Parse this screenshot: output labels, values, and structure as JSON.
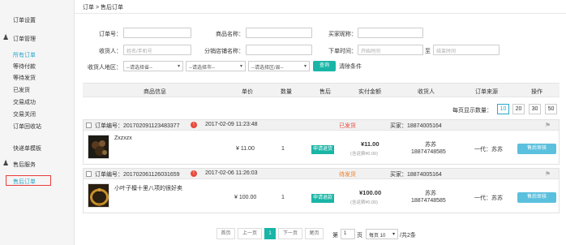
{
  "sidebar": {
    "settings": "订单设置",
    "management": "订单管理",
    "items": [
      "所有订单",
      "等待付款",
      "等待发货",
      "已发货",
      "交易成功",
      "交易关闭",
      "订单回收站"
    ],
    "express": "快递单模板",
    "aftersale": "售后服务",
    "aftersale_order": "售后订单"
  },
  "breadcrumb": "订单 > 售后订单",
  "filters": {
    "order_no": "订单号：",
    "product_name": "商品名称：",
    "buyer_nick": "买家昵称：",
    "recipient": "收货人：",
    "recipient_ph": "姓名/手机号",
    "store_name": "分销店铺名称：",
    "order_time": "下单时间：",
    "start_ph": "开始时间",
    "to": "至",
    "end_ph": "结束时间",
    "region": "收货人地区：",
    "province": "--请选择省--",
    "city": "--请选择市--",
    "district": "--请选择区/县--",
    "query": "查询",
    "clear": "清除条件"
  },
  "columns": [
    "商品信息",
    "单价",
    "数量",
    "售后",
    "实付金额",
    "收货人",
    "订单来源",
    "操作"
  ],
  "per_page": {
    "label": "每页显示数量：",
    "options": [
      "10",
      "20",
      "30",
      "50"
    ],
    "selected": "10"
  },
  "orders": [
    {
      "id_label": "订单编号：201702091123483377",
      "time": "2017-02-09 11:23:48",
      "status": "已发货",
      "buyer": "买家：18874005164",
      "product": "Zxzxzx",
      "price": "¥ 11.00",
      "qty": "1",
      "aftersale": "申请退货",
      "paid": "¥11.00",
      "shipping": "(含运费¥0.00)",
      "receiver_name": "苏苏",
      "receiver_phone": "18874748585",
      "source": "一代：苏苏",
      "action": "售后审核"
    },
    {
      "id_label": "订单编号：201702061126031659",
      "time": "2017-02-06 11:26:03",
      "status": "待发货",
      "buyer": "买家：18874005164",
      "product": "小叶子檀十里八项的很好卖",
      "price": "¥ 100.00",
      "qty": "1",
      "aftersale": "申请退款",
      "paid": "¥100.00",
      "shipping": "(含运费¥0.00)",
      "receiver_name": "苏苏",
      "receiver_phone": "18874748585",
      "source": "一代：苏苏",
      "action": "售后审核"
    }
  ],
  "pagination": {
    "first": "首页",
    "prev": "上一页",
    "current": "1",
    "next": "下一页",
    "last": "尾页",
    "goto_prefix": "第",
    "goto_value": "1",
    "goto_suffix": "页",
    "per_page": "每页 10",
    "total": "/共2条"
  },
  "colors": {
    "teal": "#19b5a6",
    "light_blue": "#5bc0de",
    "red": "#e8493b",
    "orange": "#f07d22"
  }
}
